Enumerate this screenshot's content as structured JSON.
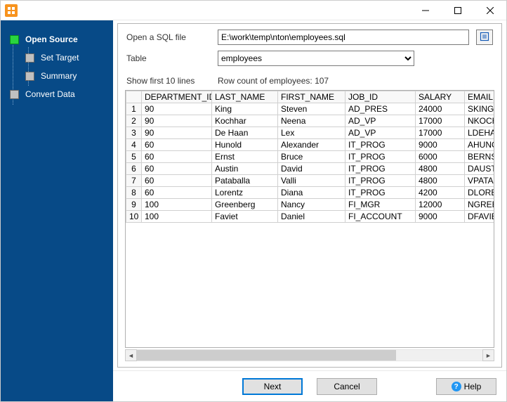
{
  "window": {
    "title": ""
  },
  "wizard": {
    "steps": [
      {
        "id": "open-source",
        "label": "Open Source",
        "current": true,
        "child": false
      },
      {
        "id": "set-target",
        "label": "Set Target",
        "current": false,
        "child": true
      },
      {
        "id": "summary",
        "label": "Summary",
        "current": false,
        "child": true
      },
      {
        "id": "convert-data",
        "label": "Convert Data",
        "current": false,
        "child": false
      }
    ]
  },
  "form": {
    "file_label": "Open a SQL file",
    "file_value": "E:\\work\\temp\\nton\\employees.sql",
    "table_label": "Table",
    "table_value": "employees",
    "show_first_label": "Show first 10 lines",
    "row_count_label": "Row count of employees: 107"
  },
  "table": {
    "columns": [
      "DEPARTMENT_ID",
      "LAST_NAME",
      "FIRST_NAME",
      "JOB_ID",
      "SALARY",
      "EMAIL"
    ],
    "rows": [
      [
        "90",
        "King",
        "Steven",
        "AD_PRES",
        "24000",
        "SKING"
      ],
      [
        "90",
        "Kochhar",
        "Neena",
        "AD_VP",
        "17000",
        "NKOCHHAR"
      ],
      [
        "90",
        "De Haan",
        "Lex",
        "AD_VP",
        "17000",
        "LDEHAAN"
      ],
      [
        "60",
        "Hunold",
        "Alexander",
        "IT_PROG",
        "9000",
        "AHUNOLD"
      ],
      [
        "60",
        "Ernst",
        "Bruce",
        "IT_PROG",
        "6000",
        "BERNST"
      ],
      [
        "60",
        "Austin",
        "David",
        "IT_PROG",
        "4800",
        "DAUSTIN"
      ],
      [
        "60",
        "Pataballa",
        "Valli",
        "IT_PROG",
        "4800",
        "VPATABAL"
      ],
      [
        "60",
        "Lorentz",
        "Diana",
        "IT_PROG",
        "4200",
        "DLORENTZ"
      ],
      [
        "100",
        "Greenberg",
        "Nancy",
        "FI_MGR",
        "12000",
        "NGREENBE"
      ],
      [
        "100",
        "Faviet",
        "Daniel",
        "FI_ACCOUNT",
        "9000",
        "DFAVIET"
      ]
    ]
  },
  "footer": {
    "next": "Next",
    "cancel": "Cancel",
    "help": "Help"
  }
}
